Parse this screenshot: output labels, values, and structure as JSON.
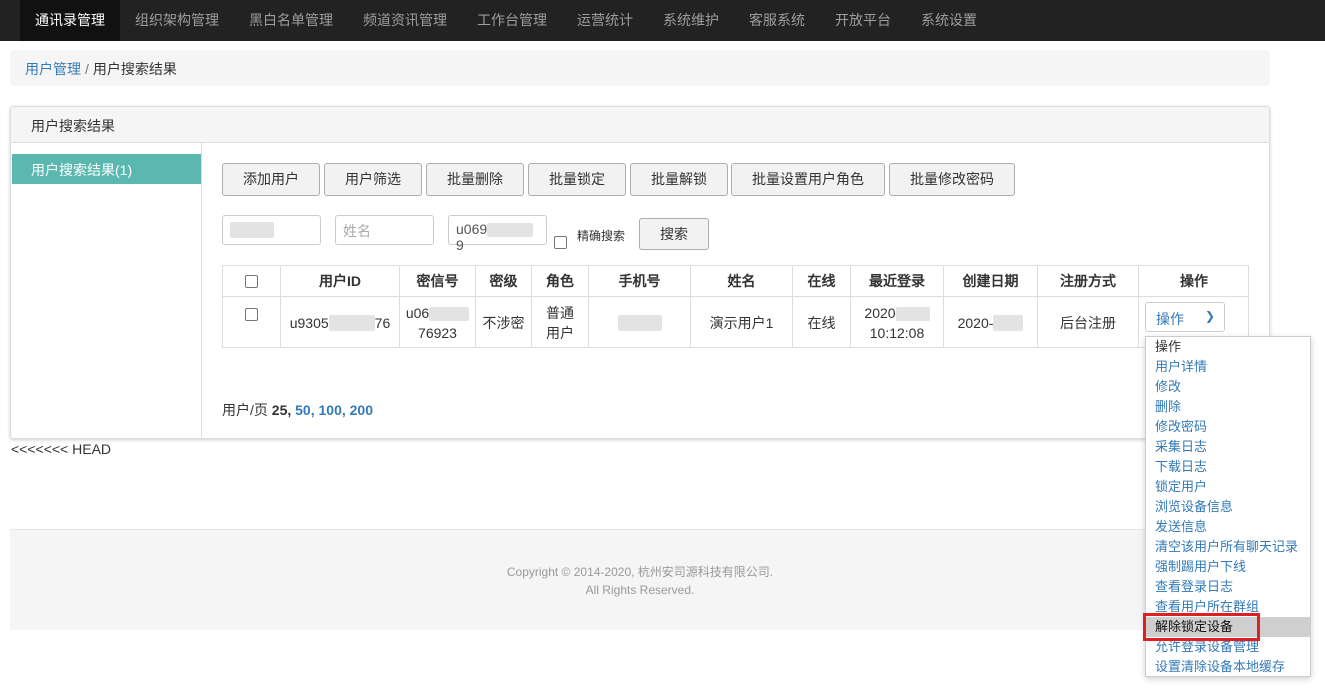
{
  "nav": {
    "items": [
      "通讯录管理",
      "组织架构管理",
      "黑白名单管理",
      "频道资讯管理",
      "工作台管理",
      "运营统计",
      "系统维护",
      "客服系统",
      "开放平台",
      "系统设置"
    ]
  },
  "breadcrumb": {
    "parent": "用户管理",
    "separator": "/",
    "current": "用户搜索结果"
  },
  "panel": {
    "title": "用户搜索结果",
    "left_item": "用户搜索结果(1)"
  },
  "toolbar": [
    "添加用户",
    "用户筛选",
    "批量删除",
    "批量锁定",
    "批量解锁",
    "批量设置用户角色",
    "批量修改密码"
  ],
  "search": {
    "name_placeholder": "姓名",
    "id_value_prefix": "u069",
    "id_value_suffix": "9",
    "exact_label": "精确搜索",
    "search_button": "搜索"
  },
  "table": {
    "headers": [
      "用户ID",
      "密信号",
      "密级",
      "角色",
      "手机号",
      "姓名",
      "在线",
      "最近登录",
      "创建日期",
      "注册方式",
      "操作"
    ],
    "row": {
      "user_id_prefix": "u9305",
      "user_id_suffix": "76",
      "mixin_prefix": "u06",
      "mixin_suffix": "76923",
      "level": "不涉密",
      "role": "普通用户",
      "name": "演示用户1",
      "online": "在线",
      "last_login_date": "2020",
      "last_login_time": "10:12:08",
      "created": "2020-",
      "register": "后台注册",
      "op_select": "操作"
    }
  },
  "pager": {
    "label": "用户/页",
    "current": "25,",
    "options": [
      "50,",
      "100,",
      "200"
    ]
  },
  "head_text": "<<<<<<< HEAD",
  "footer": {
    "copyright": "Copyright © 2014-2020, 杭州安司源科技有限公司.",
    "rights": "All Rights Reserved."
  },
  "dropdown": {
    "items": [
      "操作",
      "用户详情",
      "修改",
      "删除",
      "修改密码",
      "采集日志",
      "下载日志",
      "锁定用户",
      "浏览设备信息",
      "发送信息",
      "清空该用户所有聊天记录",
      "强制踢用户下线",
      "查看登录日志",
      "查看用户所在群组",
      "解除锁定设备",
      "允许登录设备管理",
      "设置清除设备本地缓存"
    ],
    "selected_index": 14
  },
  "colors": {
    "nav_bg": "#222222",
    "accent": "#5bb8b0",
    "link": "#337ab7",
    "highlight": "#e02020"
  }
}
